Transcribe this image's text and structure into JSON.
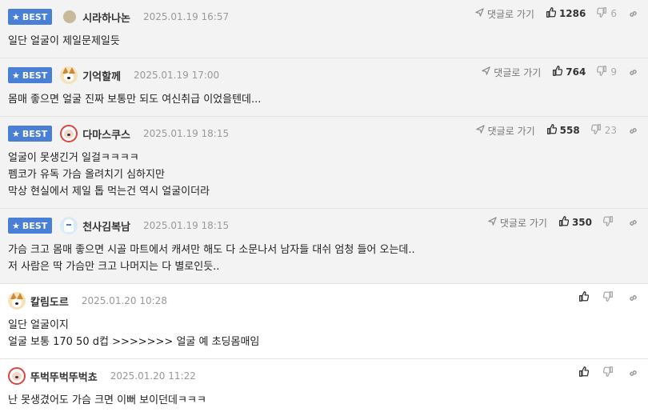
{
  "labels": {
    "best": "BEST",
    "reply": "댓글로 가기"
  },
  "colors": {
    "best_badge": "#4a7fd6",
    "best_bg": "#f3f3f3"
  },
  "comments": [
    {
      "best": true,
      "avatar": "plain-icon",
      "nick": "시라하나논",
      "time": "2025.01.19 16:57",
      "likes": "1286",
      "dislikes": "6",
      "text": "일단 얼굴이 제일문제일듯"
    },
    {
      "best": true,
      "avatar": "dog-icon",
      "nick": "기억할께",
      "time": "2025.01.19 17:00",
      "likes": "764",
      "dislikes": "9",
      "text": "몸매 좋으면 얼굴 진짜 보통만 되도 여신취급 이었을텐데..."
    },
    {
      "best": true,
      "avatar": "bear-icon",
      "nick": "다마스쿠스",
      "time": "2025.01.19 18:15",
      "likes": "558",
      "dislikes": "23",
      "text": "얼굴이 못생긴거 일걸ㅋㅋㅋㅋ\n펨코가 유독 가슴 올려치기 심하지만\n막상 현실에서 제일 톱 먹는건 역시 얼굴이더라"
    },
    {
      "best": true,
      "avatar": "ghost-icon",
      "nick": "천사김복남",
      "time": "2025.01.19 18:15",
      "likes": "350",
      "dislikes": "",
      "text": "가슴 크고 몸매 좋으면 시골 마트에서 캐셔만 해도 다 소문나서 남자들 대쉬 엄청 들어 오는데..\n저 사람은 딱 가슴만 크고 나머지는 다 별로인듯.."
    },
    {
      "best": false,
      "avatar": "dog-icon",
      "nick": "칼림도르",
      "time": "2025.01.20 10:28",
      "likes": "",
      "dislikes": "",
      "text": "일단 얼굴이지\n얼굴 보통 170 50 d컵 >>>>>>> 얼굴 예 초딩몸매임"
    },
    {
      "best": false,
      "avatar": "bear-icon",
      "nick": "뚜벅뚜벅뚜벅쵸",
      "time": "2025.01.20 11:22",
      "likes": "",
      "dislikes": "",
      "text": "난 못생겼어도 가슴 크면 이뻐 보이던데ㅋㅋㅋ"
    }
  ]
}
